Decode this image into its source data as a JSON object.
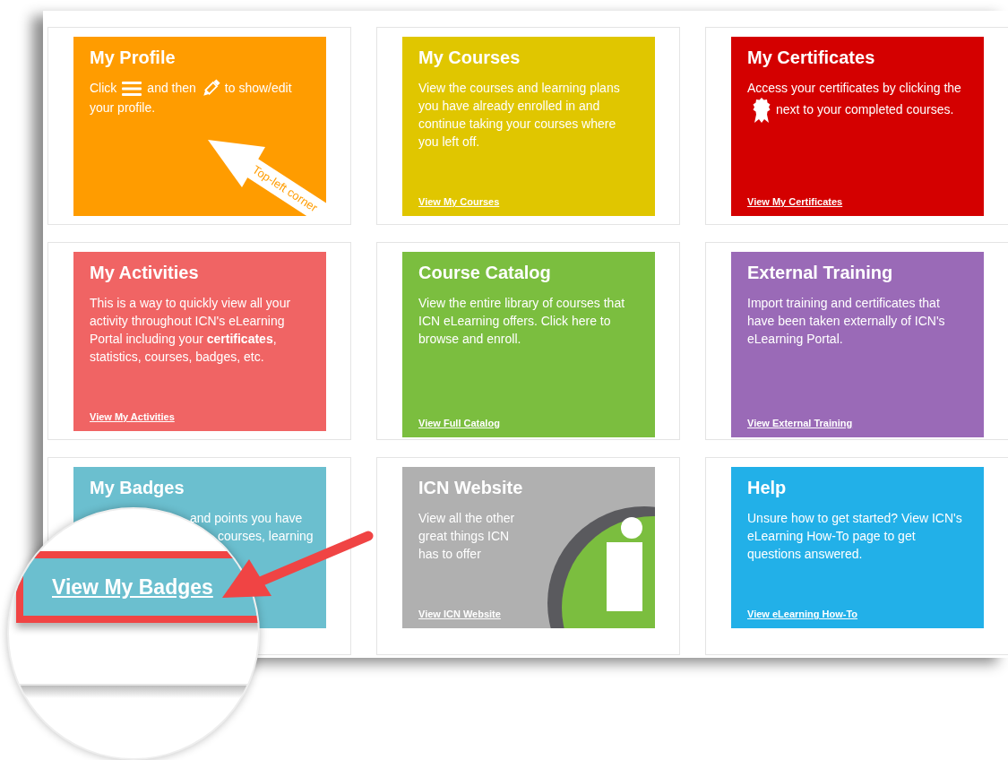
{
  "tiles": [
    {
      "kind": "profile",
      "title": "My Profile",
      "color": "#ff9c00",
      "parts": [
        "Click",
        "and then",
        "to show/edit",
        "your profile."
      ],
      "annotation": "Top-left corner"
    },
    {
      "kind": "text",
      "title": "My Courses",
      "color": "#e0c600",
      "description": "View the courses and learning plans you have already enrolled in and continue taking your courses where you left off.",
      "link": "View My Courses"
    },
    {
      "kind": "certificates",
      "title": "My Certificates",
      "color": "#d40000",
      "parts": [
        "Access your certificates by clicking",
        "the",
        "next to your completed",
        "courses."
      ],
      "link": "View My Certificates"
    },
    {
      "kind": "text",
      "title": "My Activities",
      "color": "#f06464",
      "description": "This is a way to quickly view all your activity throughout ICN's eLearning Portal including your **certificates**, statistics, courses, badges, etc.",
      "link": "View My Activities"
    },
    {
      "kind": "text",
      "title": "Course Catalog",
      "color": "#7bbe3f",
      "description": "View the entire library of courses that ICN eLearning offers. Click here to browse and enroll.",
      "link": "View Full Catalog"
    },
    {
      "kind": "text",
      "title": "External Training",
      "color": "#9a6ab7",
      "description": "Import training and certificates that have been taken externally of ICN's eLearning Portal.",
      "link": "View External Training"
    },
    {
      "kind": "partial",
      "title": "My Badges",
      "color": "#6bbfcf",
      "fragments": [
        "and points you have",
        "courses, learning"
      ]
    },
    {
      "kind": "website",
      "title": "ICN Website",
      "color": "#b0b0b0",
      "description": "View all the other great things ICN has to offer",
      "link": "View ICN Website"
    },
    {
      "kind": "text",
      "title": "Help",
      "color": "#22b0e8",
      "description": "Unsure how to get started? View ICN's eLearning How-To page to get questions answered.",
      "link": "View eLearning How-To"
    }
  ],
  "magnifier": {
    "link": "View My Badges"
  }
}
